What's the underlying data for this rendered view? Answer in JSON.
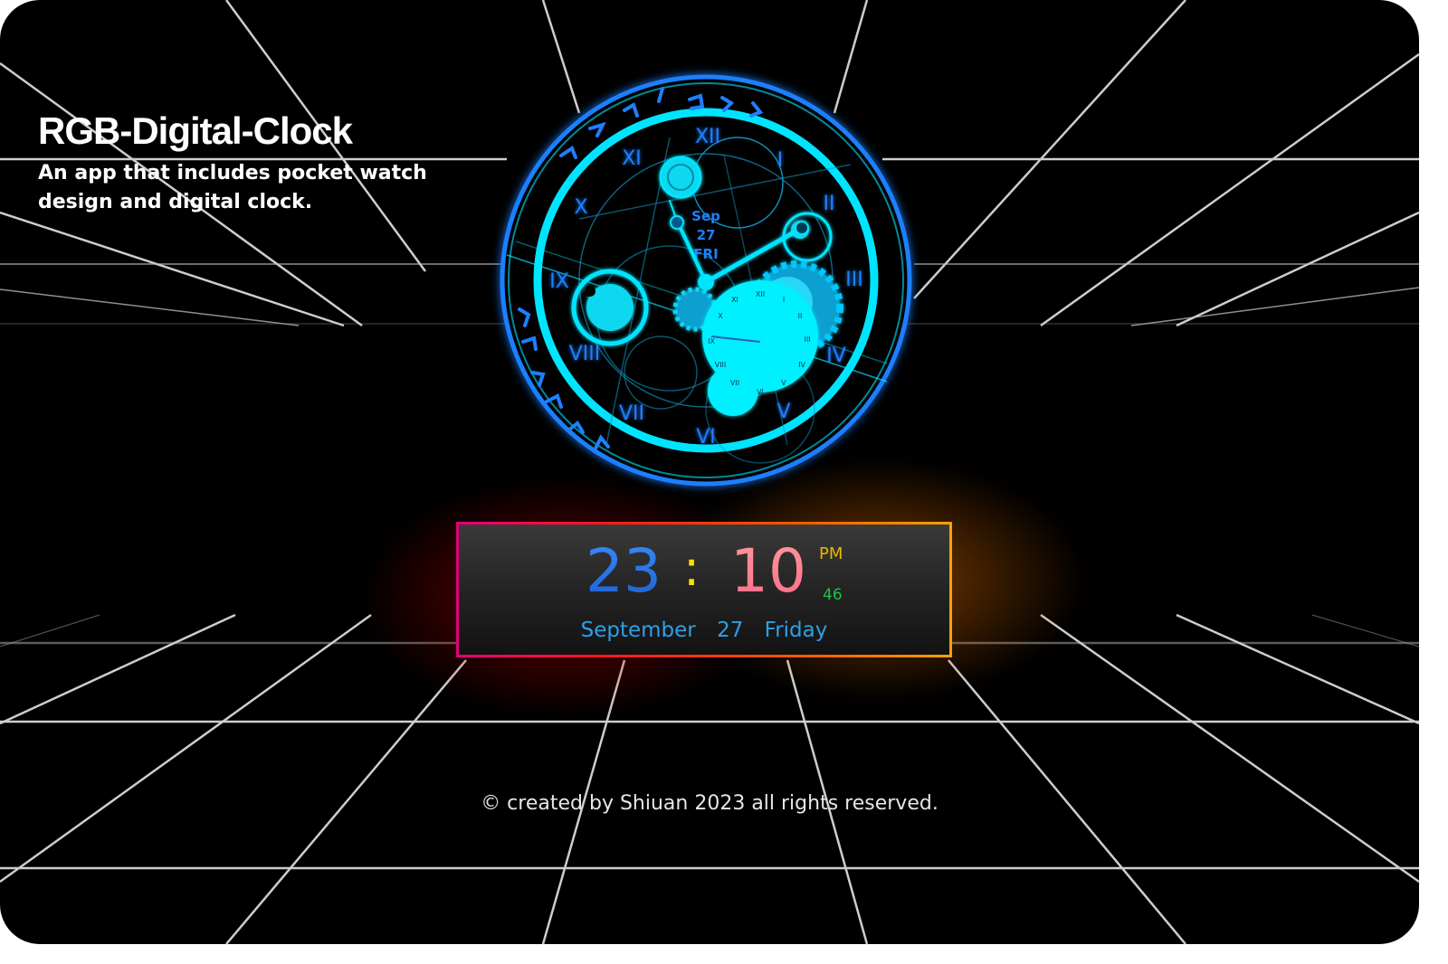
{
  "app": {
    "title": "RGB-Digital-Clock",
    "description": "An app that includes pocket watch design and digital clock."
  },
  "watch": {
    "roman_numerals": [
      "XII",
      "I",
      "II",
      "III",
      "IV",
      "V",
      "VI",
      "VII",
      "VIII",
      "IX",
      "X",
      "XI"
    ],
    "date_month": "Sep",
    "date_day": "27",
    "date_weekday": "FRI",
    "colors": {
      "primary": "#00e5ff",
      "ring": "#1e7fff"
    }
  },
  "digital_clock": {
    "hour": "23",
    "separator": ":",
    "minute": "10",
    "ampm": "PM",
    "seconds": "46",
    "date_month": "September",
    "date_day": "27",
    "date_weekday": "Friday",
    "colors": {
      "hour": "#2a7fff",
      "separator": "#ffdf00",
      "minute": "#ff7f8f",
      "ampm": "#e8b800",
      "seconds": "#23c043",
      "date": "#2f9fe6",
      "border_start": "#e0007a",
      "border_end": "#ffa000"
    }
  },
  "footer": {
    "text": "© created by Shiuan 2023 all rights reserved."
  }
}
